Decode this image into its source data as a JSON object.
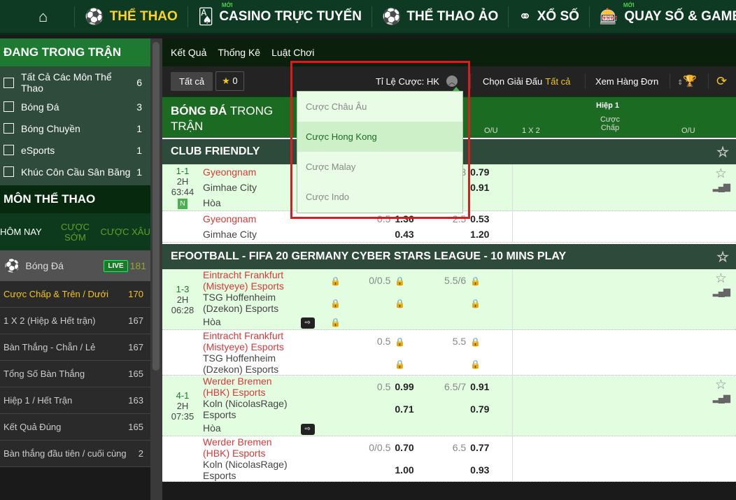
{
  "topnav": {
    "items": [
      {
        "label": "",
        "icon": "home-icon",
        "glyph": "⌂"
      },
      {
        "label": "THỂ THAO",
        "icon": "soccer-ball-icon",
        "glyph": "⚽",
        "active": true
      },
      {
        "label": "CASINO TRỰC TUYẾN",
        "icon": "cards-icon",
        "glyph": "🂡",
        "badge": "MỚI"
      },
      {
        "label": "THỂ THAO ẢO",
        "icon": "virtual-sports-icon",
        "glyph": "⚽"
      },
      {
        "label": "XỔ SỐ",
        "icon": "lottery-balls-icon",
        "glyph": "⚭"
      },
      {
        "label": "QUAY SỐ & GAMES",
        "icon": "slot-machine-icon",
        "glyph": "🎰",
        "badge": "MỚI"
      }
    ]
  },
  "sidebar": {
    "live_title": "ĐANG TRONG TRẬN",
    "live_items": [
      {
        "label": "Tất Cả Các Môn Thể Thao",
        "count": "6"
      },
      {
        "label": "Bóng Đá",
        "count": "3"
      },
      {
        "label": "Bóng Chuyền",
        "count": "1"
      },
      {
        "label": "eSports",
        "count": "1"
      },
      {
        "label": "Khúc Côn Cầu Sân Băng",
        "count": "1"
      }
    ],
    "sports_title": "MÔN THỂ THAO",
    "tabs": [
      "HÔM NAY",
      "CƯỢC SỚM",
      "CƯỢC XÂU"
    ],
    "sport": {
      "label": "Bóng Đá",
      "badge": "LIVE",
      "count": "181"
    },
    "markets": [
      {
        "label": "Cược Chấp & Trên / Dưới",
        "count": "170",
        "active": true
      },
      {
        "label": "1 X 2 (Hiệp & Hết trận)",
        "count": "167"
      },
      {
        "label": "Bàn Thắng - Chẵn / Lẻ",
        "count": "167"
      },
      {
        "label": "Tổng Số Bàn Thắng",
        "count": "165"
      },
      {
        "label": "Hiệp 1 / Hết Trận",
        "count": "163"
      },
      {
        "label": "Kết Quả Đúng",
        "count": "165"
      },
      {
        "label": "Bàn thắng đầu tiên / cuối cùng",
        "count": "2"
      }
    ]
  },
  "subnav": [
    "Kết Quả",
    "Thống Kê",
    "Luật Chơi"
  ],
  "toolbar": {
    "all": "Tất cả",
    "fav_count": "0",
    "odds_label": "Tỉ Lệ Cược:",
    "odds_value": "HK",
    "league_label": "Chọn Giải Đấu",
    "league_value": "Tất cả",
    "single_view": "Xem Hàng Đơn"
  },
  "dropdown": {
    "options": [
      "Cược Châu Âu",
      "Cược Hong Kong",
      "Cược Malay",
      "Cược Indo"
    ],
    "selected": "Cược Hong Kong"
  },
  "header": {
    "title_bold": "BÓNG ĐÁ",
    "title_rest": " TRONG TRẬN",
    "ou": "O/U",
    "x12": "1 X 2",
    "half": "Hiệp 1",
    "half_hdp": "Cược Chấp",
    "half_ou": "O/U"
  },
  "leagues": [
    {
      "name": "CLUB FRIENDLY",
      "matches": [
        {
          "bg": "g",
          "score": "1-1",
          "period": "2H",
          "time": "63:44",
          "tag": "N",
          "side": true,
          "lines": [
            {
              "team": "Gyeongnam",
              "red": true,
              "ou": "2.5/3",
              "ou_o": "0.79"
            },
            {
              "team": "Gimhae City",
              "ou_o": "0.91"
            },
            {
              "team": "Hòa"
            }
          ]
        },
        {
          "bg": "w",
          "lines": [
            {
              "team": "Gyeongnam",
              "red": true,
              "hl": "0.5",
              "ho": "1.36",
              "ou": "2.5",
              "ou_o": "0.53"
            },
            {
              "team": "Gimhae City",
              "ho": "0.43",
              "ou_o": "1.20"
            }
          ]
        }
      ]
    },
    {
      "name": "EFOOTBALL - FIFA 20 GERMANY CYBER STARS LEAGUE - 10 MINS PLAY",
      "matches": [
        {
          "bg": "g",
          "score": "1-3",
          "period": "2H",
          "time": "06:28",
          "side": true,
          "lines": [
            {
              "team": "Eintracht Frankfurt (Mistyeye) Esports",
              "red": true,
              "x12": "lock",
              "hl": "0/0.5",
              "ho": "lock",
              "ou": "5.5/6",
              "ou_o": "lock"
            },
            {
              "team": "TSG Hoffenheim (Dzekon) Esports",
              "x12": "lock",
              "ho": "lock",
              "ou_o": "lock"
            },
            {
              "team": "Hòa",
              "tv": "⇨",
              "x12": "lock"
            }
          ]
        },
        {
          "bg": "w",
          "lines": [
            {
              "team": "Eintracht Frankfurt (Mistyeye) Esports",
              "red": true,
              "hl": "0.5",
              "ho": "lock",
              "ou": "5.5",
              "ou_o": "lock"
            },
            {
              "team": "TSG Hoffenheim (Dzekon) Esports",
              "ho": "lock",
              "ou_o": "lock"
            }
          ]
        },
        {
          "bg": "g",
          "score": "4-1",
          "period": "2H",
          "time": "07:35",
          "side": true,
          "lines": [
            {
              "team": "Werder Bremen (HBK) Esports",
              "red": true,
              "hl": "0.5",
              "ho": "0.99",
              "ou": "6.5/7",
              "ou_o": "0.91"
            },
            {
              "team": "Koln (NicolasRage) Esports",
              "ho": "0.71",
              "ou_o": "0.79"
            },
            {
              "team": "Hòa",
              "tv": "⇨"
            }
          ]
        },
        {
          "bg": "w",
          "lines": [
            {
              "team": "Werder Bremen (HBK) Esports",
              "red": true,
              "hl": "0/0.5",
              "ho": "0.70",
              "ou": "6.5",
              "ou_o": "0.77"
            },
            {
              "team": "Koln (NicolasRage) Esports",
              "ho": "1.00",
              "ou_o": "0.93"
            }
          ]
        }
      ]
    }
  ]
}
